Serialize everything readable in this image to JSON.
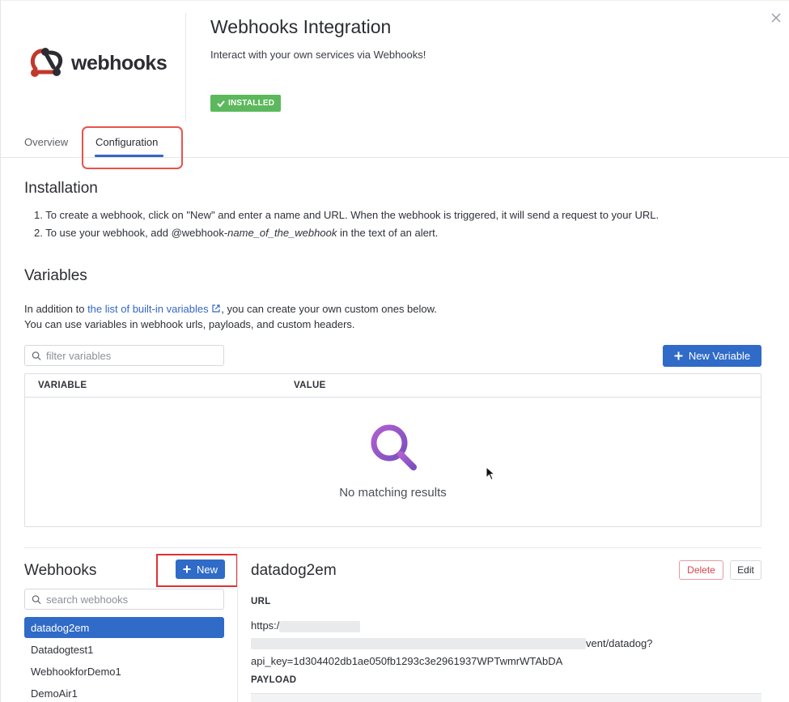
{
  "header": {
    "logo_text": "webhooks",
    "title": "Webhooks Integration",
    "subtitle": "Interact with your own services via Webhooks!",
    "badge": "INSTALLED"
  },
  "tabs": [
    {
      "label": "Overview",
      "active": false
    },
    {
      "label": "Configuration",
      "active": true
    }
  ],
  "installation": {
    "heading": "Installation",
    "step1": "1. To create a webhook, click on \"New\" and enter a name and URL. When the webhook is triggered, it will send a request to your URL.",
    "step2_prefix": "2. To use your webhook, add @webhook-",
    "step2_em": "name_of_the_webhook",
    "step2_suffix": " in the text of an alert."
  },
  "variables": {
    "heading": "Variables",
    "desc_prefix": "In addition to ",
    "desc_link": "the list of built-in variables",
    "desc_suffix": ", you can create your own custom ones below.",
    "desc_line2": "You can use variables in webhook urls, payloads, and custom headers.",
    "filter_placeholder": "filter variables",
    "new_button": "New Variable",
    "col_variable": "VARIABLE",
    "col_value": "VALUE",
    "empty_text": "No matching results"
  },
  "webhooks": {
    "heading": "Webhooks",
    "new_button": "New",
    "search_placeholder": "search webhooks",
    "items": [
      {
        "label": "datadog2em",
        "active": true
      },
      {
        "label": "Datadogtest1",
        "active": false
      },
      {
        "label": "WebhookforDemo1",
        "active": false
      },
      {
        "label": "DemoAir1",
        "active": false
      }
    ]
  },
  "detail": {
    "title": "datadog2em",
    "delete_label": "Delete",
    "edit_label": "Edit",
    "url_label": "URL",
    "url_prefix": "https:/",
    "url_mid": "vent/datadog?",
    "url_line2": "api_key=1d304402db1ae050fb1293c3e2961937WPTwmrWTAbDA",
    "payload_label": "PAYLOAD"
  },
  "colors": {
    "accent": "#2f6bc7",
    "installed_badge": "#5cb85c",
    "highlight_red": "#e03131",
    "search_icon_purple": "#9b59b6"
  }
}
